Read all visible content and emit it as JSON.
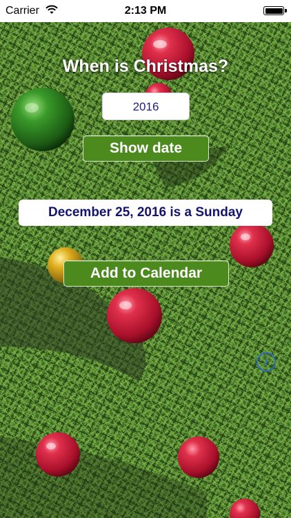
{
  "status_bar": {
    "carrier": "Carrier",
    "time": "2:13 PM"
  },
  "app": {
    "title": "When is Christmas?",
    "year_value": "2016",
    "show_date_label": "Show date",
    "result_text": "December 25, 2016 is a Sunday",
    "add_calendar_label": "Add to Calendar",
    "info_icon": "info-icon"
  },
  "colors": {
    "button_green": "#4c8a1e",
    "result_text": "#14146e",
    "info_blue": "#2a6fc0"
  }
}
